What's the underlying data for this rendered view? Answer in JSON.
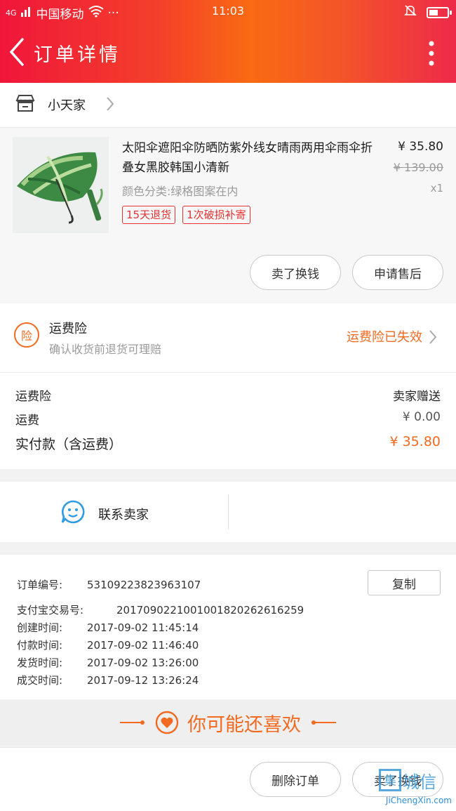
{
  "status_bar": {
    "network": "4G",
    "carrier": "中国移动",
    "time": "11:03",
    "dots": "···"
  },
  "header": {
    "title": "订单详情"
  },
  "shop": {
    "name": "小天家"
  },
  "item": {
    "title": "太阳伞遮阳伞防晒防紫外线女晴雨两用伞雨伞折叠女黑胶韩国小清新",
    "sku": "颜色分类:绿格图案在内",
    "price": "¥ 35.80",
    "original_price": "¥ 139.00",
    "quantity": "x1",
    "tags": [
      "15天退货",
      "1次破损补寄"
    ],
    "buttons": {
      "resell": "卖了换钱",
      "after_sale": "申请售后"
    }
  },
  "insurance": {
    "icon_text": "险",
    "title": "运费险",
    "subtitle": "确认收货前退货可理赔",
    "status": "运费险已失效"
  },
  "fees": [
    {
      "label": "运费险",
      "value": "卖家赠送"
    },
    {
      "label": "运费",
      "value": "¥ 0.00"
    },
    {
      "label": "实付款（含运费）",
      "value": "¥ 35.80"
    }
  ],
  "contact": {
    "label": "联系卖家"
  },
  "order_meta": {
    "copy_label": "复制",
    "rows": [
      {
        "label": "订单编号:",
        "value": "53109223823963107"
      },
      {
        "label": "支付宝交易号:",
        "value": "2017090221001001820262616259"
      },
      {
        "label": "创建时间:",
        "value": "2017-09-02 11:45:14"
      },
      {
        "label": "付款时间:",
        "value": "2017-09-02 11:46:40"
      },
      {
        "label": "发货时间:",
        "value": "2017-09-02 13:26:00"
      },
      {
        "label": "成交时间:",
        "value": "2017-09-12 13:26:24"
      }
    ]
  },
  "recommend": {
    "title": "你可能还喜欢"
  },
  "bottom_bar": {
    "delete": "删除订单",
    "resell": "卖了换钱"
  },
  "watermark": {
    "brand": "城信",
    "url": "JiChengXin.com",
    "box": "集"
  },
  "colors": {
    "accent": "#f16a20",
    "red": "#e63232",
    "header_start": "#f0163a",
    "header_mid": "#f96a12"
  }
}
